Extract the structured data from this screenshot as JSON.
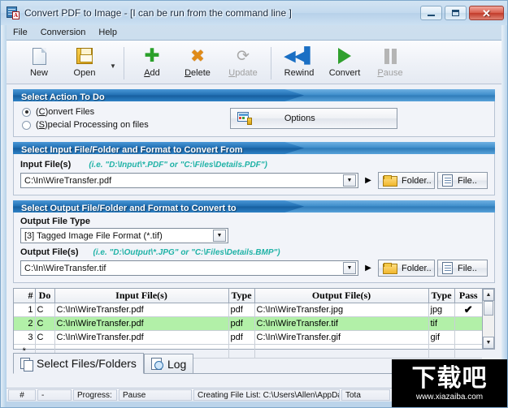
{
  "window": {
    "title": "Convert PDF to Image - [I can be run from the command line ]",
    "app_icon": "pdf-document-icon",
    "minimize_label": "–",
    "maximize_label": "□",
    "close_label": "✕"
  },
  "menubar": {
    "items": [
      {
        "label": "File"
      },
      {
        "label": "Conversion"
      },
      {
        "label": "Help"
      }
    ]
  },
  "toolbar": {
    "buttons": [
      {
        "label": "New",
        "icon": "new-page-icon",
        "enabled": true,
        "accel": ""
      },
      {
        "label": "Open",
        "icon": "save-disk-icon",
        "enabled": true,
        "accel": ""
      },
      {
        "label": "Add",
        "icon": "green-plus-icon",
        "enabled": true,
        "accel": "A"
      },
      {
        "label": "Delete",
        "icon": "orange-x-icon",
        "enabled": true,
        "accel": "D"
      },
      {
        "label": "Update",
        "icon": "update-icon",
        "enabled": false,
        "accel": "U"
      },
      {
        "label": "Rewind",
        "icon": "rewind-icon",
        "enabled": true,
        "accel": ""
      },
      {
        "label": "Convert",
        "icon": "play-triangle-icon",
        "enabled": true,
        "accel": ""
      },
      {
        "label": "Pause",
        "icon": "pause-bars-icon",
        "enabled": false,
        "accel": "P"
      }
    ],
    "dropdown_arrow": "▼"
  },
  "action_panel": {
    "header": "Select Action To Do",
    "radio_convert_pre": "(",
    "radio_convert_key": "C",
    "radio_convert_post": ")onvert Files",
    "radio_special_pre": "(",
    "radio_special_key": "S",
    "radio_special_post": ")pecial Processing on files",
    "selected": "convert",
    "options_button": "Options",
    "options_icon": "options-settings-icon"
  },
  "input_panel": {
    "header": "Select Input File/Folder and Format to Convert From",
    "label": "Input File(s)",
    "hint": "(i.e. \"D:\\Input\\*.PDF\"  or \"C:\\Files\\Details.PDF\")",
    "value": "C:\\In\\WireTransfer.pdf",
    "dropdown_arrow": "▼",
    "go_arrow": "▶",
    "folder_button": "Folder..",
    "file_button": "File.."
  },
  "output_panel": {
    "header": "Select Output File/Folder and Format to Convert to",
    "type_label": "Output File Type",
    "type_value": "[3] Tagged Image File Format (*.tif)",
    "type_dropdown_arrow": "▼",
    "label": "Output File(s)",
    "hint": "(i.e. \"D:\\Output\\*.JPG\"  or \"C:\\Files\\Details.BMP\")",
    "value": "C:\\In\\WireTransfer.tif",
    "dropdown_arrow": "▼",
    "go_arrow": "▶",
    "folder_button": "Folder..",
    "file_button": "File.."
  },
  "grid": {
    "columns": [
      "#",
      "Do",
      "Input File(s)",
      "Type",
      "Output File(s)",
      "Type",
      "Pass"
    ],
    "rows": [
      {
        "num": "1",
        "do": "C",
        "input": "C:\\In\\WireTransfer.pdf",
        "in_type": "pdf",
        "output": "C:\\In\\WireTransfer.jpg",
        "out_type": "jpg",
        "pass": "✔",
        "selected": false
      },
      {
        "num": "2",
        "do": "C",
        "input": "C:\\In\\WireTransfer.pdf",
        "in_type": "pdf",
        "output": "C:\\In\\WireTransfer.tif",
        "out_type": "tif",
        "pass": "",
        "selected": true
      },
      {
        "num": "3",
        "do": "C",
        "input": "C:\\In\\WireTransfer.pdf",
        "in_type": "pdf",
        "output": "C:\\In\\WireTransfer.gif",
        "out_type": "gif",
        "pass": "",
        "selected": false
      },
      {
        "num": "*",
        "do": "",
        "input": "",
        "in_type": "",
        "output": "",
        "out_type": "",
        "pass": "",
        "selected": false
      }
    ],
    "scroll_up": "▲",
    "scroll_down": "▼"
  },
  "tabs": [
    {
      "label": "Select Files/Folders",
      "icon": "files-stack-icon",
      "active": true
    },
    {
      "label": "Log",
      "icon": "log-clock-icon",
      "active": false
    }
  ],
  "statusbar": {
    "hash_label": "#",
    "hash_value": "-",
    "progress_label": "Progress:",
    "progress_value": "Pause",
    "message": "Creating File List: C:\\Users\\Allen\\AppData\\",
    "total_label": "Tota"
  },
  "watermark": {
    "text": "下载吧",
    "url": "www.xiazaiba.com"
  },
  "colors": {
    "panel_header": "#2170b4",
    "selected_row": "#b2f0a8",
    "hint_text": "#1fb2a6",
    "pass_check": "#1d8c1d"
  }
}
